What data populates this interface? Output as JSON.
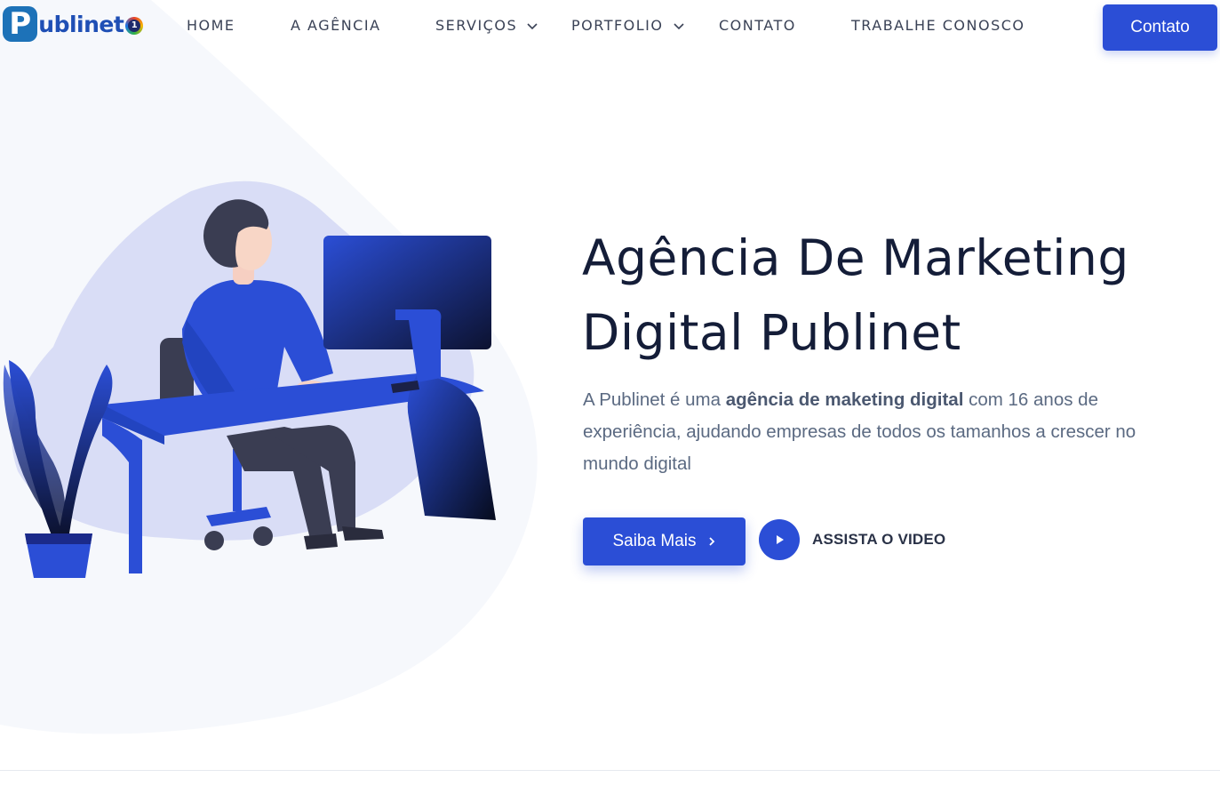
{
  "brand": {
    "logo_letter": "P",
    "logo_text": "ublinet",
    "logo_badge": "1"
  },
  "nav": {
    "items": [
      {
        "label": "HOME"
      },
      {
        "label": "A AGÊNCIA"
      },
      {
        "label": "SERVIÇOS",
        "has_dropdown": true
      },
      {
        "label": "PORTFOLIO",
        "has_dropdown": true
      },
      {
        "label": "CONTATO"
      },
      {
        "label": "TRABALHE CONOSCO"
      }
    ],
    "cta_label": "Contato"
  },
  "hero": {
    "title_line1": "Agência De Marketing",
    "title_line2": "Digital Publinet",
    "text_before": "A Publinet é uma ",
    "text_bold": "agência de maketing digital",
    "text_after": " com 16 anos de experiência, ajudando empresas de todos os tamanhos a crescer no mundo digital",
    "primary_button": "Saiba Mais",
    "video_label": "ASSISTA O VIDEO"
  },
  "colors": {
    "accent": "#2b4ed6",
    "heading": "#141d38",
    "body_text": "#5b6a82",
    "background_blob": "#f6f8fc"
  },
  "icons": {
    "dropdown": "chevron-down-icon",
    "primary_button": "chevron-right-icon",
    "video": "play-icon"
  }
}
